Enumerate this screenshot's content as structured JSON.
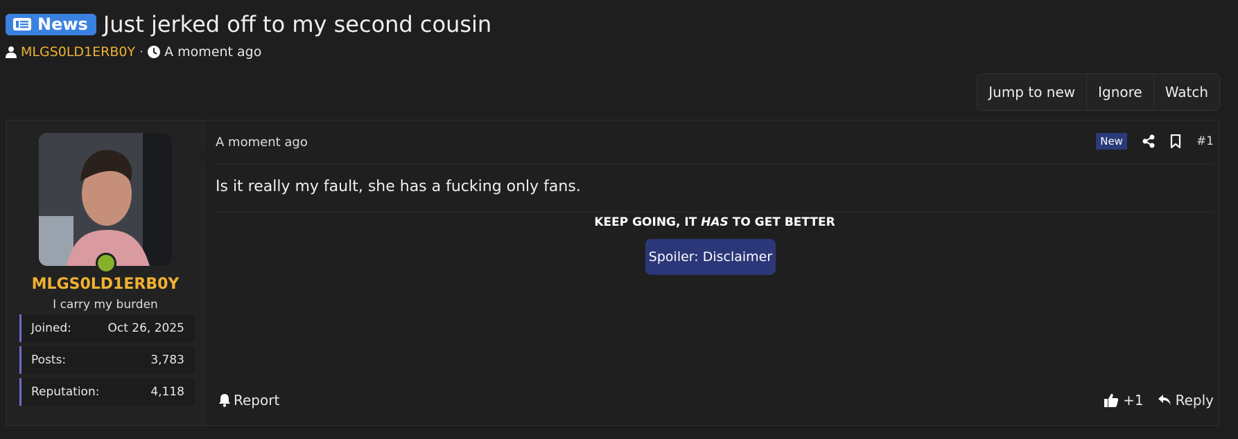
{
  "thread": {
    "prefix": "News",
    "title": "Just jerked off to my second cousin",
    "author": "MLGS0LD1ERB0Y",
    "separator": "·",
    "time": "A moment ago"
  },
  "thread_actions": {
    "jump_to_new": "Jump to new",
    "ignore": "Ignore",
    "watch": "Watch"
  },
  "post": {
    "date": "A moment ago",
    "new_badge": "New",
    "number": "#1",
    "body": "Is it really my fault, she has a fucking only fans.",
    "signature": {
      "before": "KEEP GOING, IT ",
      "emphasis": "HAS",
      "after": " TO GET BETTER"
    },
    "spoiler_label": "Spoiler: Disclaimer",
    "report_label": "Report",
    "reaction_count": "+1",
    "reply_label": "Reply"
  },
  "user": {
    "username": "MLGS0LD1ERB0Y",
    "user_title": "I carry my burden",
    "stats": [
      {
        "label": "Joined:",
        "value": "Oct 26, 2025"
      },
      {
        "label": "Posts:",
        "value": "3,783"
      },
      {
        "label": "Reputation:",
        "value": "4,118"
      }
    ],
    "online": true
  },
  "colors": {
    "background": "#1e1e1e",
    "prefix_badge": "#3b82e0",
    "username": "#f0b132",
    "online": "#86b02a",
    "spoiler": "#2b3778",
    "new_badge": "#2a3b7a",
    "stat_accent": "#6b6bd1"
  }
}
